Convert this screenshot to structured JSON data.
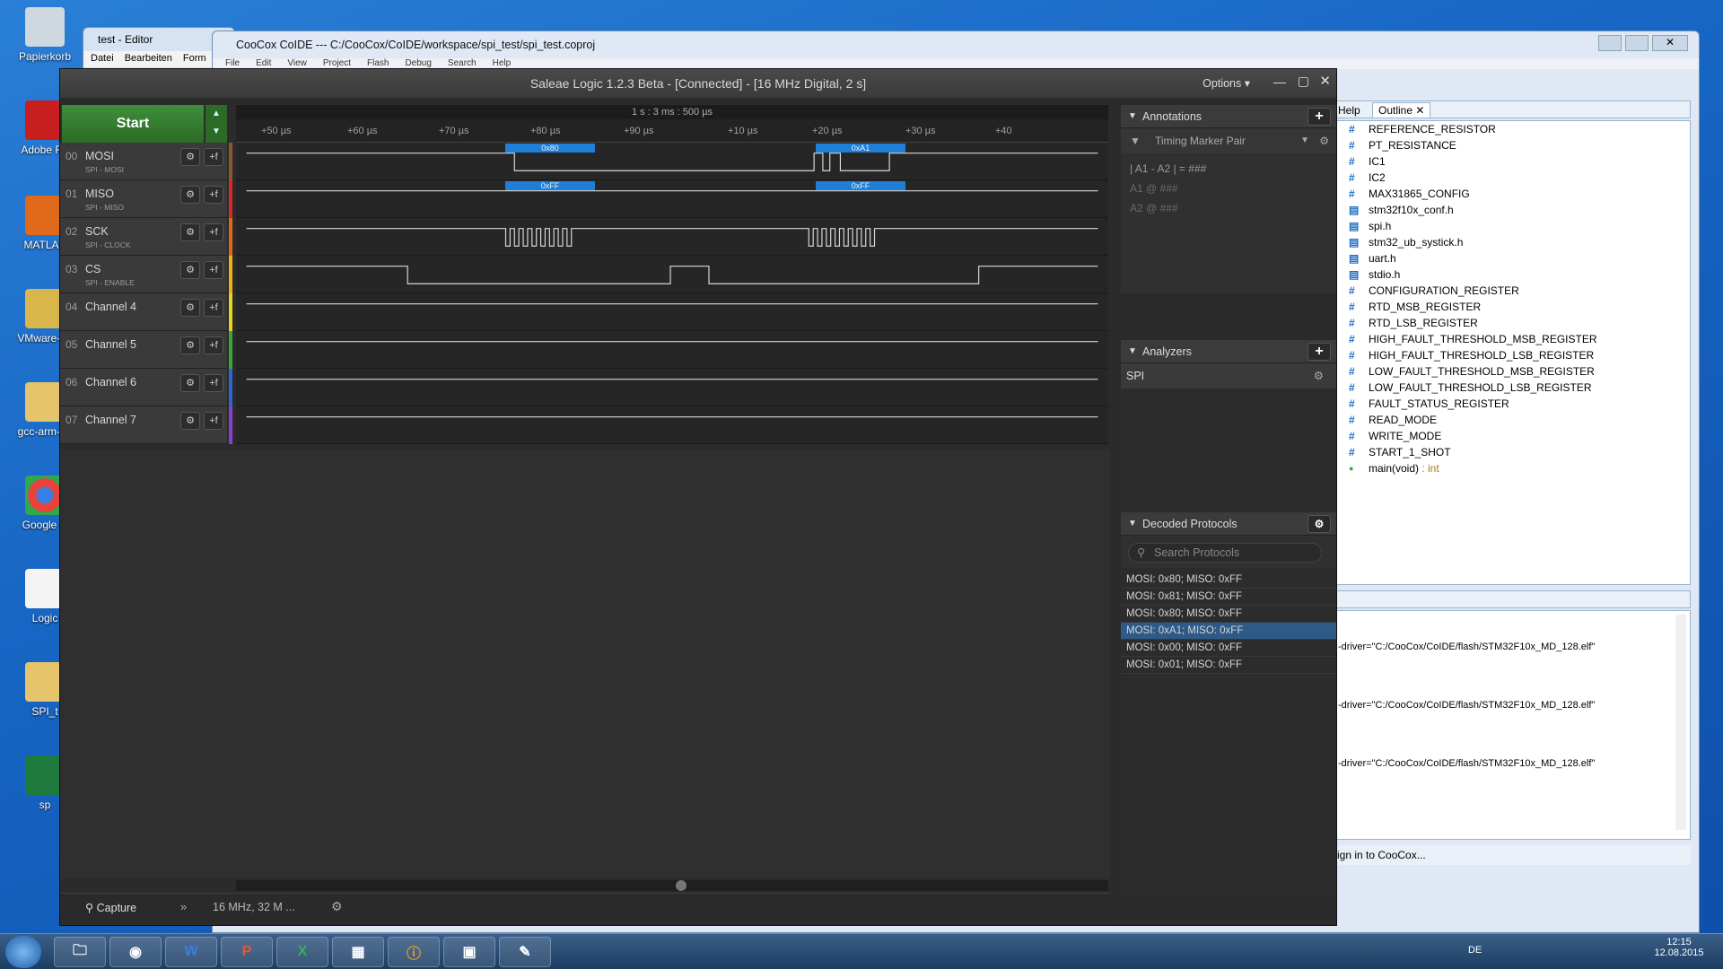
{
  "desktop": {
    "icons": [
      {
        "label": "Papierkorb"
      },
      {
        "label": "Adobe Re"
      },
      {
        "label": "MATLAB"
      },
      {
        "label": "VMware-Or"
      },
      {
        "label": "gcc-arm-no"
      },
      {
        "label": "Google C"
      },
      {
        "label": "Logic"
      },
      {
        "label": "SPI_t"
      },
      {
        "label": "sp"
      }
    ]
  },
  "editor_window": {
    "title": "test - Editor",
    "menu": [
      "Datei",
      "Bearbeiten",
      "Form"
    ]
  },
  "coide_window": {
    "title": "CooCox CoIDE --- C:/CooCox/CoIDE/workspace/spi_test/spi_test.coproj",
    "menu": [
      "File",
      "Edit",
      "View",
      "Project",
      "Flash",
      "Debug",
      "Search",
      "Help"
    ]
  },
  "saleae": {
    "title": "Saleae Logic 1.2.3 Beta - [Connected] - [16 MHz Digital, 2 s]",
    "options_label": "Options ▾",
    "start_label": "Start",
    "time_header": "1 s : 3 ms : 500 µs",
    "ticks": [
      "+50 µs",
      "+60 µs",
      "+70 µs",
      "+80 µs",
      "+90 µs",
      "+10 µs",
      "+20 µs",
      "+30 µs",
      "+40"
    ],
    "channels": [
      {
        "num": "00",
        "name": "MOSI",
        "sub": "SPI - MOSI",
        "color": "#8b5a2b"
      },
      {
        "num": "01",
        "name": "MISO",
        "sub": "SPI - MISO",
        "color": "#d8262a"
      },
      {
        "num": "02",
        "name": "SCK",
        "sub": "SPI - CLOCK",
        "color": "#e06a14"
      },
      {
        "num": "03",
        "name": "CS",
        "sub": "SPI - ENABLE",
        "color": "#e8b21a"
      },
      {
        "num": "04",
        "name": "Channel 4",
        "sub": "",
        "color": "#e6d41e"
      },
      {
        "num": "05",
        "name": "Channel 5",
        "sub": "",
        "color": "#38a838"
      },
      {
        "num": "06",
        "name": "Channel 6",
        "sub": "",
        "color": "#2f63d6"
      },
      {
        "num": "07",
        "name": "Channel 7",
        "sub": "",
        "color": "#8a3ed0"
      }
    ],
    "mosi_labels": [
      "0x80",
      "0xA1"
    ],
    "miso_labels": [
      "0xFF",
      "0xFF"
    ],
    "bottom": {
      "capture": "Capture",
      "rate": "16 MHz, 32 M ..."
    },
    "annotations": {
      "title": "Annotations",
      "marker_pair": "Timing Marker Pair",
      "formula": "| A1 - A2 | = ###",
      "a1": "A1  @  ###",
      "a2": "A2  @  ###"
    },
    "analyzers": {
      "title": "Analyzers",
      "items": [
        "SPI"
      ]
    },
    "decoded": {
      "title": "Decoded Protocols",
      "search_placeholder": "Search Protocols",
      "rows": [
        "MOSI: 0x80;  MISO: 0xFF",
        "MOSI: 0x81;  MISO: 0xFF",
        "MOSI: 0x80;  MISO: 0xFF",
        "MOSI: 0xA1;  MISO: 0xFF",
        "MOSI: 0x00;  MISO: 0xFF",
        "MOSI: 0x01;  MISO: 0xFF"
      ],
      "selected_index": 3
    }
  },
  "outline": {
    "tabs": [
      "Help",
      "Outline"
    ],
    "items": [
      "REFERENCE_RESISTOR",
      "PT_RESISTANCE",
      "IC1",
      "IC2",
      "MAX31865_CONFIG",
      "stm32f10x_conf.h",
      "spi.h",
      "stm32_ub_systick.h",
      "uart.h",
      "stdio.h",
      "CONFIGURATION_REGISTER",
      "RTD_MSB_REGISTER",
      "RTD_LSB_REGISTER",
      "HIGH_FAULT_THRESHOLD_MSB_REGISTER",
      "HIGH_FAULT_THRESHOLD_LSB_REGISTER",
      "LOW_FAULT_THRESHOLD_MSB_REGISTER",
      "LOW_FAULT_THRESHOLD_LSB_REGISTER",
      "FAULT_STATUS_REGISTER",
      "READ_MODE",
      "WRITE_MODE",
      "START_1_SHOT"
    ],
    "main_item": "main(void)",
    "main_type": " : int"
  },
  "console": {
    "lines": [
      "-driver=\"C:/CooCox/CoIDE/flash/STM32F10x_MD_128.elf\"",
      "-driver=\"C:/CooCox/CoIDE/flash/STM32F10x_MD_128.elf\"",
      "-driver=\"C:/CooCox/CoIDE/flash/STM32F10x_MD_128.elf\""
    ],
    "status": "ign in to CooCox..."
  },
  "taskbar": {
    "lang": "DE",
    "time": "12:15",
    "date": "12.08.2015"
  }
}
